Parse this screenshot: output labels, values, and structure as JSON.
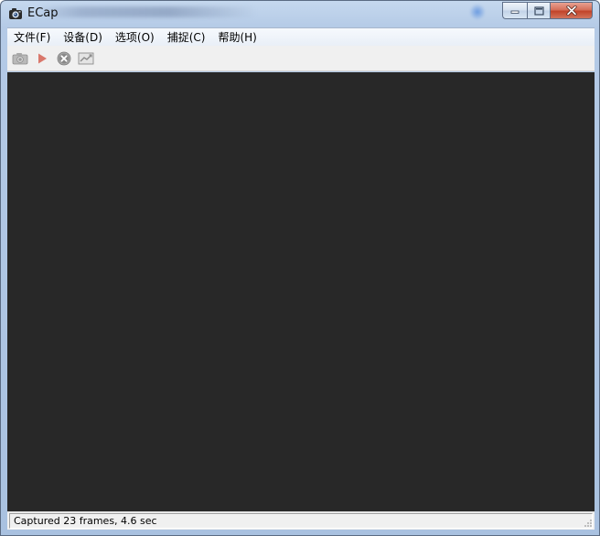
{
  "window": {
    "title": "ECap"
  },
  "menu": {
    "items": [
      {
        "label": "文件(F)"
      },
      {
        "label": "设备(D)"
      },
      {
        "label": "选项(O)"
      },
      {
        "label": "捕捉(C)"
      },
      {
        "label": "帮助(H)"
      }
    ]
  },
  "toolbar": {
    "buttons": [
      {
        "icon": "camera-icon"
      },
      {
        "icon": "play-icon"
      },
      {
        "icon": "stop-icon"
      },
      {
        "icon": "graph-icon"
      }
    ]
  },
  "status": {
    "text": "Captured 23 frames, 4.6 sec"
  },
  "colors": {
    "preview_background": "#282828",
    "play_icon": "#d9776b",
    "close_button": "#c84a30"
  }
}
